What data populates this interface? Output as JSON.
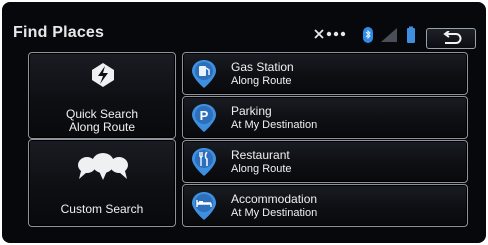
{
  "header": {
    "title": "Find Places"
  },
  "left_buttons": [
    {
      "icon": "lightning-icon",
      "line1": "Quick Search",
      "line2": "Along Route"
    },
    {
      "icon": "speech-bubbles-icon",
      "line1": "Custom Search",
      "line2": ""
    }
  ],
  "categories": [
    {
      "icon": "gas-pump-icon",
      "title": "Gas Station",
      "subtitle": "Along Route"
    },
    {
      "icon": "parking-icon",
      "title": "Parking",
      "subtitle": "At My Destination"
    },
    {
      "icon": "restaurant-icon",
      "title": "Restaurant",
      "subtitle": "Along Route"
    },
    {
      "icon": "bed-icon",
      "title": "Accommodation",
      "subtitle": "At My Destination"
    }
  ],
  "colors": {
    "accent": "#3f8fe0",
    "background": "#07080b",
    "border": "#8e939b"
  }
}
